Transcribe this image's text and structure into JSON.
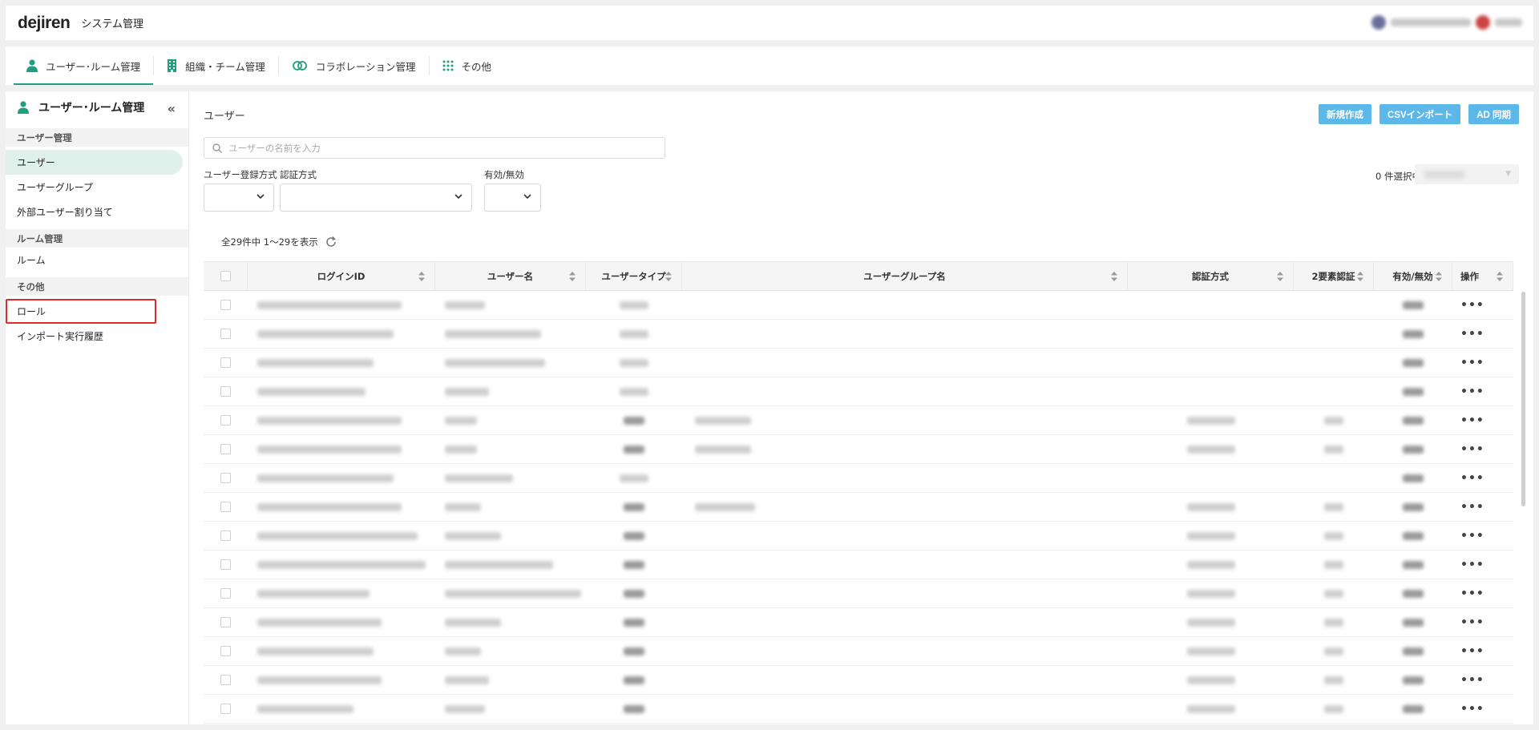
{
  "header": {
    "logo": "dejiren",
    "title": "システム管理"
  },
  "topnav": [
    {
      "label": "ユーザー･ルーム管理",
      "icon": "person-icon"
    },
    {
      "label": "組織・チーム管理",
      "icon": "building-icon"
    },
    {
      "label": "コラボレーション管理",
      "icon": "link-icon"
    },
    {
      "label": "その他",
      "icon": "grid-icon"
    }
  ],
  "sidebar": {
    "title": "ユーザー･ルーム管理",
    "sections": [
      {
        "label": "ユーザー管理",
        "items": [
          "ユーザー",
          "ユーザーグループ",
          "外部ユーザー割り当て"
        ]
      },
      {
        "label": "ルーム管理",
        "items": [
          "ルーム"
        ]
      },
      {
        "label": "その他",
        "items": [
          "ロール",
          "インポート実行履歴"
        ]
      }
    ]
  },
  "main": {
    "title": "ユーザー",
    "buttons": {
      "create": "新規作成",
      "csv": "CSVインポート",
      "ad": "AD 同期"
    },
    "search_placeholder": "ユーザーの名前を入力",
    "filters": {
      "reg": "ユーザー登録方式",
      "auth": "認証方式",
      "enabled": "有効/無効"
    },
    "selected": "0 件選択中",
    "count": "全29件中 1〜29を表示"
  },
  "table": {
    "headers": [
      "ログインID",
      "ユーザー名",
      "ユーザータイプ",
      "ユーザーグループ名",
      "認証方式",
      "2要素認証",
      "有効/無効",
      "操作"
    ]
  },
  "colors": {
    "accent": "#1f9f7f",
    "button": "#5bb8e8",
    "highlight": "#e02b2b"
  }
}
